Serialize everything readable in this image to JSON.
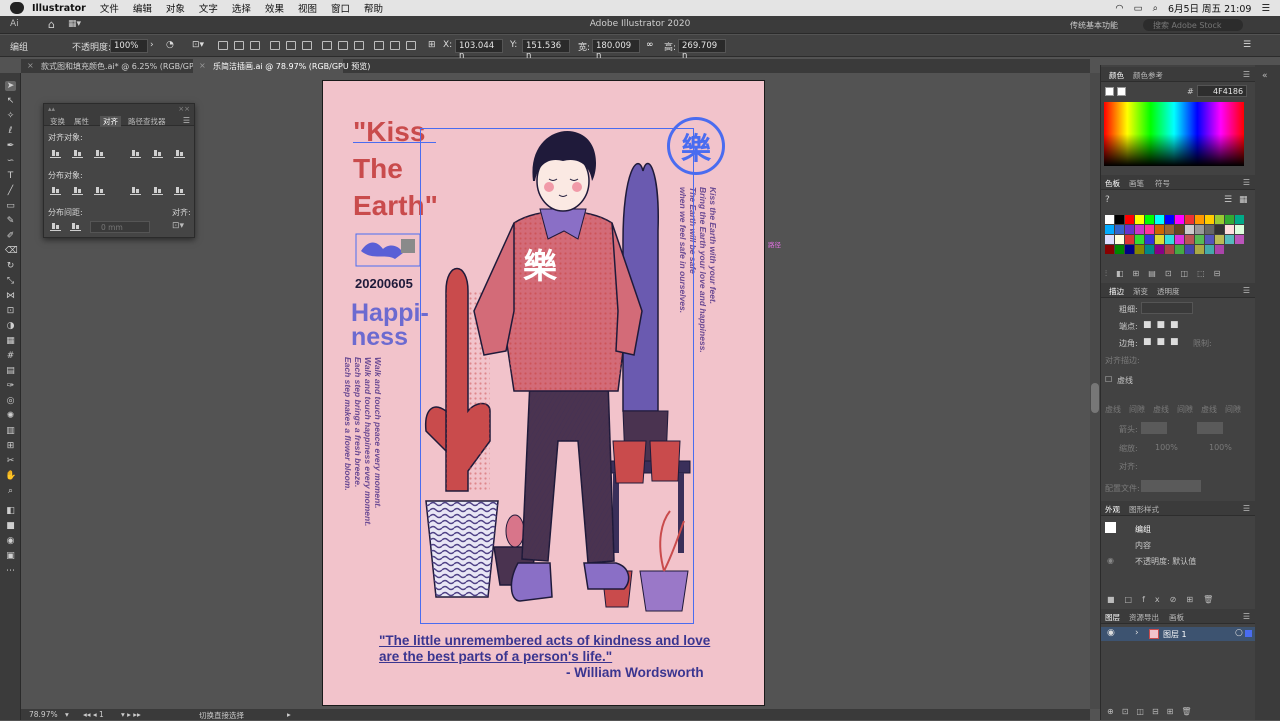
{
  "menubar": {
    "app_name": "Illustrator",
    "items": [
      "文件",
      "编辑",
      "对象",
      "文字",
      "选择",
      "效果",
      "视图",
      "窗口",
      "帮助"
    ],
    "datetime": "6月5日 周五 21:09"
  },
  "window": {
    "title": "Adobe Illustrator 2020"
  },
  "appbar": {
    "workspace": "传统基本功能",
    "stock_placeholder": "搜索 Adobe Stock"
  },
  "control_bar": {
    "selection_label": "编组",
    "opacity_label": "不透明度:",
    "opacity_value": "100%",
    "x_label": "X:",
    "x_value": "103.044 n",
    "y_label": "Y:",
    "y_value": "151.536 n",
    "w_label": "宽:",
    "w_value": "180.009 n",
    "h_label": "高:",
    "h_value": "269.709 n"
  },
  "doc_tabs": [
    {
      "label": "款式图和填充颜色.ai* @ 6.25% (RGB/GPU 预览)",
      "active": false
    },
    {
      "label": "乐简洁插画.ai @ 78.97% (RGB/GPU 预览)",
      "active": true
    }
  ],
  "align_panel": {
    "tabs": [
      "变换",
      "属性",
      "对齐",
      "路径查找器"
    ],
    "active_tab": "对齐",
    "align_objects_label": "对齐对象:",
    "distribute_objects_label": "分布对象:",
    "distribute_spacing_label": "分布间距:",
    "align_to_label": "对齐:",
    "spacing_value": "0 mm"
  },
  "artwork": {
    "title_lines": [
      "\"Kiss",
      "The",
      "Earth\""
    ],
    "date": "20200605",
    "happiness_lines": [
      "Happi-",
      "ness"
    ],
    "badge_char": "樂",
    "shirt_char": "樂",
    "poem_left": [
      "Walk and touch peace every moment.",
      "Walk and touch happiness every moment.",
      "Each step brings a fresh breeze.",
      "Each step makes a flower bloom."
    ],
    "poem_right": [
      "Kiss the Earth with your feet.",
      "Bring the Earth your love and happiness.",
      "The Earth will be safe",
      "when we feel safe in ourselves."
    ],
    "quote_line1": "\"The little unremembered acts of kindness and love",
    "quote_line2": "are the best parts of a person's life.\"",
    "quote_author": "-  William Wordsworth",
    "path_label": "路径"
  },
  "right_panel": {
    "color_tabs": [
      "颜色",
      "颜色参考"
    ],
    "hex_label": "#",
    "hex_value": "4F4186",
    "swatch_tabs": [
      "色板",
      "画笔",
      "符号"
    ],
    "stroke_tabs": [
      "描边",
      "渐变",
      "透明度"
    ],
    "stroke_weight_label": "粗细:",
    "cap_label": "端点:",
    "corner_label": "边角:",
    "limit_label": "限制:",
    "align_stroke_label": "对齐描边:",
    "dashed_label": "虚线",
    "dash_labels": [
      "虚线",
      "间隙",
      "虚线",
      "间隙",
      "虚线",
      "间隙"
    ],
    "arrowheads_label": "箭头:",
    "scale_label": "缩放:",
    "scale_values": [
      "100%",
      "100%"
    ],
    "align_label": "对齐:",
    "profile_label": "配置文件:",
    "appearance_tabs": [
      "外观",
      "图形样式"
    ],
    "appearance_group": "编组",
    "appearance_contents": "内容",
    "appearance_opacity": "不透明度: 默认值",
    "layers_tabs": [
      "图层",
      "资源导出",
      "画板"
    ],
    "layer_name": "图层 1"
  },
  "status_bar": {
    "zoom": "78.97%",
    "artboard": "1",
    "tool_hint": "切换直接选择"
  },
  "colors": {
    "accent_blue": "#4F4186",
    "poster_bg": "#f2c3cb",
    "title_red": "#c94b4c",
    "quote_blue": "#3a3590",
    "selection_blue": "#4a6cf0"
  }
}
